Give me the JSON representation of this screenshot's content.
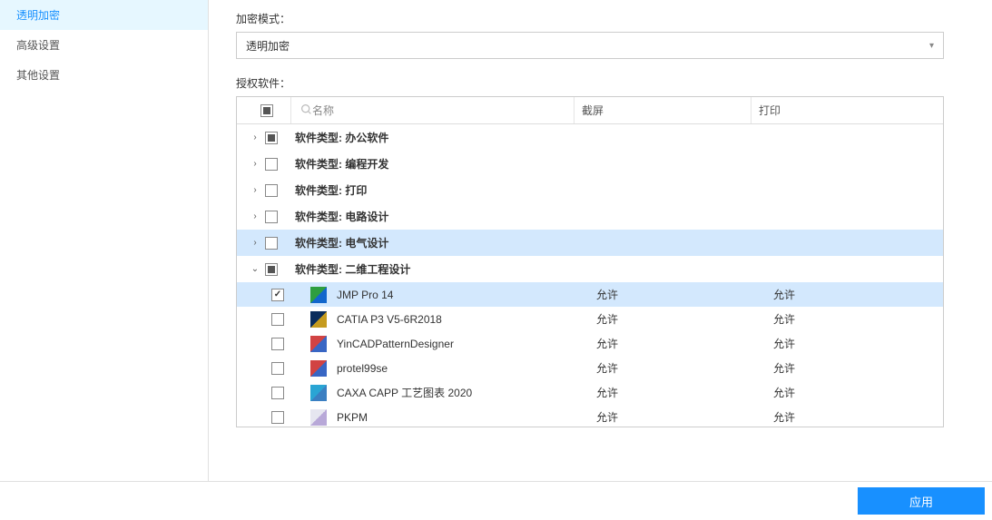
{
  "sidebar": {
    "items": [
      {
        "label": "透明加密",
        "active": true
      },
      {
        "label": "高级设置",
        "active": false
      },
      {
        "label": "其他设置",
        "active": false
      }
    ]
  },
  "main": {
    "mode_label": "加密模式：",
    "mode_value": "透明加密",
    "auth_label": "授权软件：",
    "columns": {
      "name": "名称",
      "screenshot": "截屏",
      "print": "打印"
    },
    "category_prefix": "软件类型:",
    "categories": [
      {
        "label": "办公软件",
        "expanded": false,
        "check": "indeterminate",
        "highlighted": false
      },
      {
        "label": "编程开发",
        "expanded": false,
        "check": "unchecked",
        "highlighted": false
      },
      {
        "label": "打印",
        "expanded": false,
        "check": "unchecked",
        "highlighted": false
      },
      {
        "label": "电路设计",
        "expanded": false,
        "check": "unchecked",
        "highlighted": false
      },
      {
        "label": "电气设计",
        "expanded": false,
        "check": "unchecked",
        "highlighted": true
      },
      {
        "label": "二维工程设计",
        "expanded": true,
        "check": "indeterminate",
        "highlighted": false
      }
    ],
    "software": [
      {
        "name": "JMP Pro 14",
        "screenshot": "允许",
        "print": "允许",
        "checked": true,
        "highlighted": true,
        "color1": "#2e9e3f",
        "color2": "#1166cc"
      },
      {
        "name": "CATIA P3 V5-6R2018",
        "screenshot": "允许",
        "print": "允许",
        "checked": false,
        "highlighted": false,
        "color1": "#0a2d5c",
        "color2": "#c59b1f"
      },
      {
        "name": "YinCADPatternDesigner",
        "screenshot": "允许",
        "print": "允许",
        "checked": false,
        "highlighted": false,
        "color1": "#d14343",
        "color2": "#3866c4"
      },
      {
        "name": "protel99se",
        "screenshot": "允许",
        "print": "允许",
        "checked": false,
        "highlighted": false,
        "color1": "#d14343",
        "color2": "#3866c4"
      },
      {
        "name": "CAXA CAPP 工艺图表 2020",
        "screenshot": "允许",
        "print": "允许",
        "checked": false,
        "highlighted": false,
        "color1": "#2aa5d4",
        "color2": "#3b7fc2"
      },
      {
        "name": "PKPM",
        "screenshot": "允许",
        "print": "允许",
        "checked": false,
        "highlighted": false,
        "color1": "#e6e6f0",
        "color2": "#b8a8d8"
      }
    ]
  },
  "footer": {
    "apply": "应用"
  }
}
